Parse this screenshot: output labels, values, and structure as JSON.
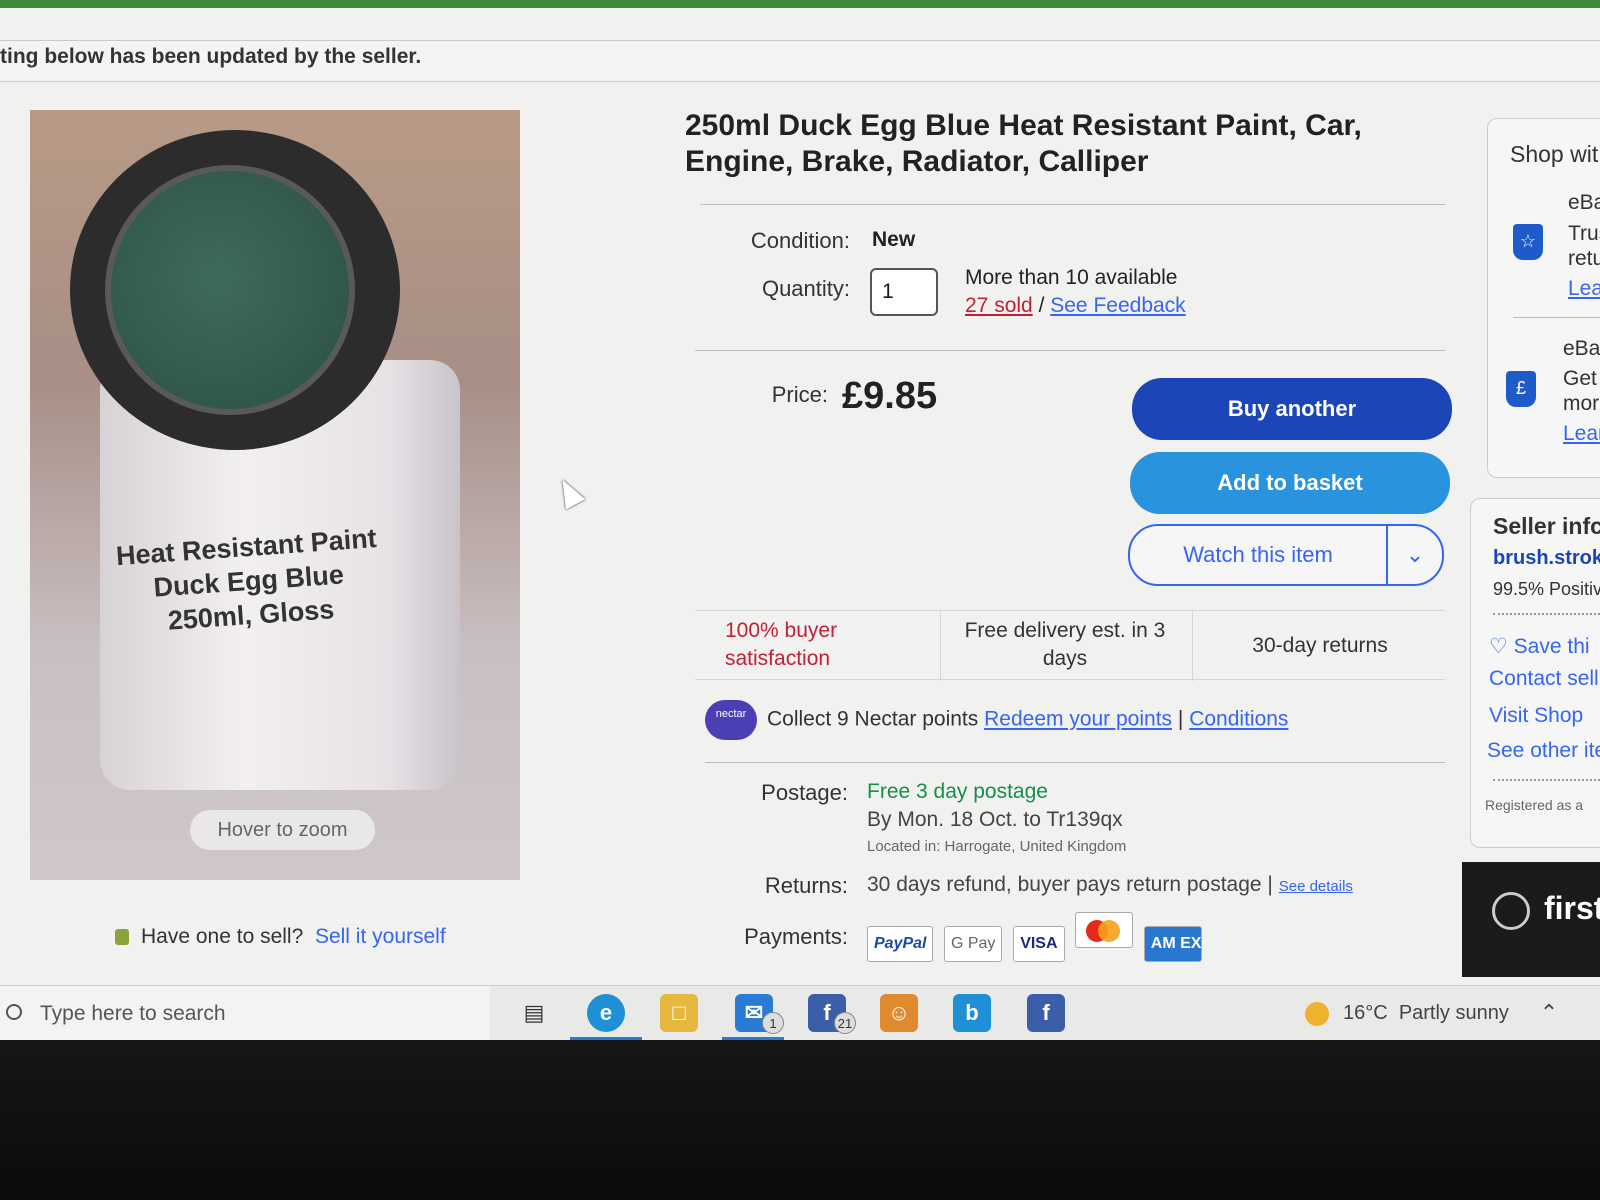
{
  "notice": "ting below has been updated by the seller.",
  "image": {
    "can_label_lines": [
      "Heat Resistant Paint",
      "Duck Egg Blue",
      "250ml, Gloss"
    ],
    "zoom_hint": "Hover to zoom"
  },
  "sell": {
    "text": "Have one to sell?",
    "link": "Sell it yourself"
  },
  "item": {
    "title": "250ml Duck Egg Blue Heat Resistant Paint, Car, Engine, Brake, Radiator, Calliper",
    "condition_label": "Condition:",
    "condition_value": "New",
    "quantity_label": "Quantity:",
    "quantity_value": "1",
    "availability": "More than 10 available",
    "sold": "27 sold",
    "sold_sep": "/",
    "feedback": "See Feedback",
    "price_label": "Price:",
    "price": "£9.85"
  },
  "actions": {
    "buy": "Buy another",
    "basket": "Add to basket",
    "watch": "Watch this item"
  },
  "features": [
    "100% buyer satisfaction",
    "Free delivery est. in 3 days",
    "30-day returns"
  ],
  "nectar": {
    "logo": "nectar",
    "text": "Collect 9 Nectar points",
    "redeem": "Redeem your points",
    "sep": "|",
    "conditions": "Conditions"
  },
  "postage": {
    "label": "Postage:",
    "value": "Free 3 day postage",
    "eta": "By Mon. 18 Oct. to Tr139qx",
    "location": "Located in: Harrogate, United Kingdom"
  },
  "returns": {
    "label": "Returns:",
    "value": "30 days refund, buyer pays return postage |",
    "link": "See details"
  },
  "payments": {
    "label": "Payments:",
    "methods": [
      "PayPal",
      "G Pay",
      "VISA",
      "",
      "AM EX"
    ]
  },
  "shop_box": {
    "title": "Shop wit",
    "item1_head": "eBa",
    "item1_line1": "Trus",
    "item1_line2": "retu",
    "item1_link": "Lea",
    "item2_head": "eBa",
    "item2_line1": "Get",
    "item2_line2": "mor",
    "item2_link": "Lear"
  },
  "seller": {
    "title": "Seller infc",
    "name": "brush.strok",
    "positive": "99.5% Positiv",
    "save": "Save thi",
    "contact": "Contact sell",
    "visit": "Visit Shop",
    "see_other": "See other ite",
    "registered": "Registered as a"
  },
  "ad": {
    "text": "first"
  },
  "taskbar": {
    "search_placeholder": "Type here to search",
    "mail_count": "1",
    "fb_count": "21",
    "weather_temp": "16°C",
    "weather_desc": "Partly sunny"
  },
  "colors": {
    "buy_button": "#1c45b8",
    "basket_button": "#2a93de",
    "link": "#3665f3",
    "sold": "#c22036",
    "postage_green": "#168f48"
  }
}
